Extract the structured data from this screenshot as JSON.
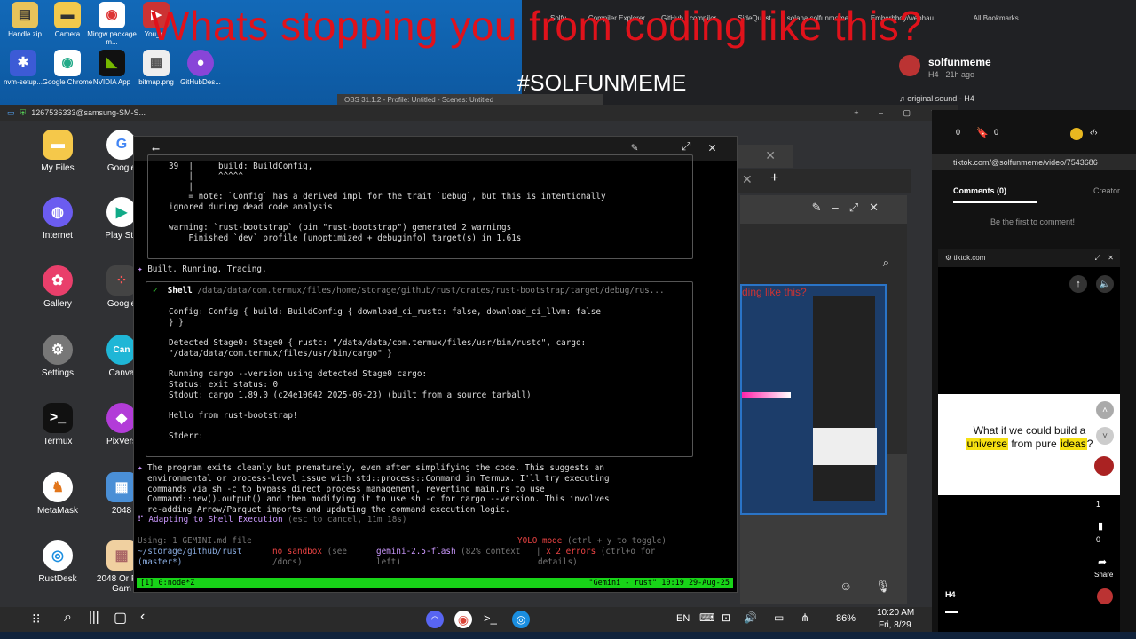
{
  "overlay": {
    "title": "Whats stopping you from coding like this?",
    "hashtag": "#SOLFUNMEME"
  },
  "desktop_icons": [
    {
      "label": "Handle.zip"
    },
    {
      "label": "Camera"
    },
    {
      "label": "Mingw package m..."
    },
    {
      "label": "You_r..."
    },
    {
      "label": "nvm-setup..."
    },
    {
      "label": "Google Chrome"
    },
    {
      "label": "NVIDIA App"
    },
    {
      "label": "bitmap.png"
    },
    {
      "label": "GitHubDes..."
    }
  ],
  "browser": {
    "bookmarks": [
      "Solfu...",
      "Compiler Explorer",
      "GitHub - compiler...",
      "SideQuest",
      "solana solfunmeme...",
      "Emberbboy/webhau...",
      "All Bookmarks"
    ],
    "tiktok_user": "solfunmeme",
    "tiktok_meta": "H4 · 21h ago",
    "sound": "original sound - H4",
    "likes": "0",
    "saves": "0",
    "url": "tiktok.com/@solfunmeme/video/7543686",
    "tab_comments": "Comments (0)",
    "tab_creator": "Creator",
    "empty_comments": "Be the first to comment!"
  },
  "remote": {
    "title": "1267536333@samsung-SM-S...",
    "obs": "OBS 31.1.2 - Profile: Untitled - Scenes: Untitled"
  },
  "android_apps": [
    {
      "label": "My Files"
    },
    {
      "label": "Google"
    },
    {
      "label": "Internet"
    },
    {
      "label": "Play Sto"
    },
    {
      "label": "Gallery"
    },
    {
      "label": "Google"
    },
    {
      "label": "Settings"
    },
    {
      "label": "Canva"
    },
    {
      "label": "Termux"
    },
    {
      "label": "PixVers"
    },
    {
      "label": "MetaMask"
    },
    {
      "label": "2048"
    },
    {
      "label": "RustDesk"
    },
    {
      "label": "2048 Or Fun Gam"
    }
  ],
  "terminal": {
    "lines_top": [
      "39  |     build: BuildConfig,",
      "    |     ^^^^^",
      "    |",
      "    = note: `Config` has a derived impl for the trait `Debug`, but this is intentionally",
      "ignored during dead code analysis",
      "",
      "warning: `rust-bootstrap` (bin \"rust-bootstrap\") generated 2 warnings",
      "    Finished `dev` profile [unoptimized + debuginfo] target(s) in 1.61s"
    ],
    "built": "Built. Running. Tracing.",
    "shell_label": "Shell",
    "shell_path": "/data/data/com.termux/files/home/storage/github/rust/crates/rust-bootstrap/target/debug/rus...",
    "shell_lines": [
      "Config: Config { build: BuildConfig { download_ci_rustc: false, download_ci_llvm: false",
      "} }",
      "",
      "Detected Stage0: Stage0 { rustc: \"/data/data/com.termux/files/usr/bin/rustc\", cargo:",
      "\"/data/data/com.termux/files/usr/bin/cargo\" }",
      "",
      "Running cargo --version using detected Stage0 cargo:",
      "Status: exit status: 0",
      "Stdout: cargo 1.89.0 (c24e10642 2025-06-23) (built from a source tarball)",
      "",
      "Hello from rust-bootstrap!",
      "",
      "Stderr:"
    ],
    "message_lines": [
      "The program exits cleanly but prematurely, even after simplifying the code. This suggests an",
      "environmental or process-level issue with std::process::Command in Termux. I'll try executing",
      "commands via sh -c to bypass direct process management, reverting main.rs to use",
      "Command::new().output() and then modifying it to use sh -c for cargo --version. This involves",
      "re-adding Arrow/Parquet imports and updating the command execution logic."
    ],
    "adapting": "Adapting to Shell Execution",
    "adapting_hint": "(esc to cancel, 11m 18s)",
    "using": "Using: 1 GEMINI.md file",
    "yolo": "YOLO mode",
    "yolo_hint": "(ctrl + y to toggle)",
    "cwd": "~/storage/github/rust",
    "branch": "(master*)",
    "sandbox": "no sandbox",
    "sandbox_hint": "(see",
    "sandbox_hint2": "/docs)",
    "model": "gemini-2.5-flash",
    "context": "(82% context",
    "context2": "left)",
    "errors": "x 2 errors",
    "errors_hint": "(ctrl+o for",
    "errors_hint2": "details)",
    "status_left": "[1] 0:node*Z",
    "status_right": "\"Gemini - rust\" 10:19 29-Aug-25"
  },
  "tiktok_mini": {
    "url": "tiktok.com",
    "caption_pre": "What if we could build a",
    "caption_hl": "universe",
    "caption_mid": "from pure",
    "caption_hl2": "ideas",
    "caption_post": "?",
    "count1": "1",
    "count2": "0",
    "share": "Share",
    "author": "H4"
  },
  "system": {
    "lang": "EN",
    "battery": "86%",
    "time": "10:20 AM",
    "date": "Fri, 8/29"
  }
}
